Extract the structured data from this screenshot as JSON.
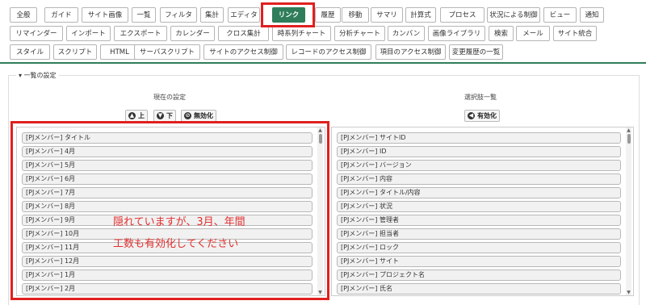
{
  "tabs": [
    {
      "label": "全般"
    },
    {
      "label": "ガイド"
    },
    {
      "label": "サイト画像"
    },
    {
      "label": "一覧"
    },
    {
      "label": "フィルタ"
    },
    {
      "label": "集計"
    },
    {
      "label": "エディタ"
    },
    {
      "label": "リンク",
      "active": true
    },
    {
      "label": "履歴"
    },
    {
      "label": "移動"
    },
    {
      "label": "サマリ"
    },
    {
      "label": "計算式"
    },
    {
      "label": "プロセス"
    },
    {
      "label": "状況による制御"
    },
    {
      "label": "ビュー"
    },
    {
      "label": "通知"
    },
    {
      "label": "リマインダー"
    },
    {
      "label": "インポート"
    },
    {
      "label": "エクスポート"
    },
    {
      "label": "カレンダー"
    },
    {
      "label": "クロス集計"
    },
    {
      "label": "時系列チャート"
    },
    {
      "label": "分析チャート"
    },
    {
      "label": "カンバン"
    },
    {
      "label": "画像ライブラリ"
    },
    {
      "label": "検索"
    },
    {
      "label": "メール"
    },
    {
      "label": "サイト統合"
    },
    {
      "label": "スタイル"
    },
    {
      "label": "スクリプト"
    },
    {
      "label": "HTML"
    },
    {
      "label": "サーバスクリプト"
    },
    {
      "label": "サイトのアクセス制御"
    },
    {
      "label": "レコードのアクセス制御"
    },
    {
      "label": "項目のアクセス制御"
    },
    {
      "label": "変更履歴の一覧"
    }
  ],
  "section": {
    "legend": "一覧の設定",
    "toggle_icon": "caret-down-icon"
  },
  "left": {
    "title": "現在の設定",
    "buttons": {
      "up": "上",
      "down": "下",
      "disable": "無効化"
    },
    "items": [
      "[PJメンバー] タイトル",
      "[PJメンバー] 4月",
      "[PJメンバー] 5月",
      "[PJメンバー] 6月",
      "[PJメンバー] 7月",
      "[PJメンバー] 8月",
      "[PJメンバー] 9月",
      "[PJメンバー] 10月",
      "[PJメンバー] 11月",
      "[PJメンバー] 12月",
      "[PJメンバー] 1月",
      "[PJメンバー] 2月"
    ]
  },
  "right": {
    "title": "選択肢一覧",
    "buttons": {
      "enable": "有効化"
    },
    "items": [
      "[PJメンバー] サイトID",
      "[PJメンバー] ID",
      "[PJメンバー] バージョン",
      "[PJメンバー] 内容",
      "[PJメンバー] タイトル/内容",
      "[PJメンバー] 状況",
      "[PJメンバー] 管理者",
      "[PJメンバー] 担当者",
      "[PJメンバー] ロック",
      "[PJメンバー] サイト",
      "[PJメンバー] プロジェクト名",
      "[PJメンバー] 氏名"
    ]
  },
  "annotation": {
    "line1": "隠れていますが、3月、年間",
    "line2": "工数も有効化してください"
  },
  "colors": {
    "accent": "#2f7d5a",
    "highlight": "#e02020",
    "annotation_text": "#e23030"
  }
}
